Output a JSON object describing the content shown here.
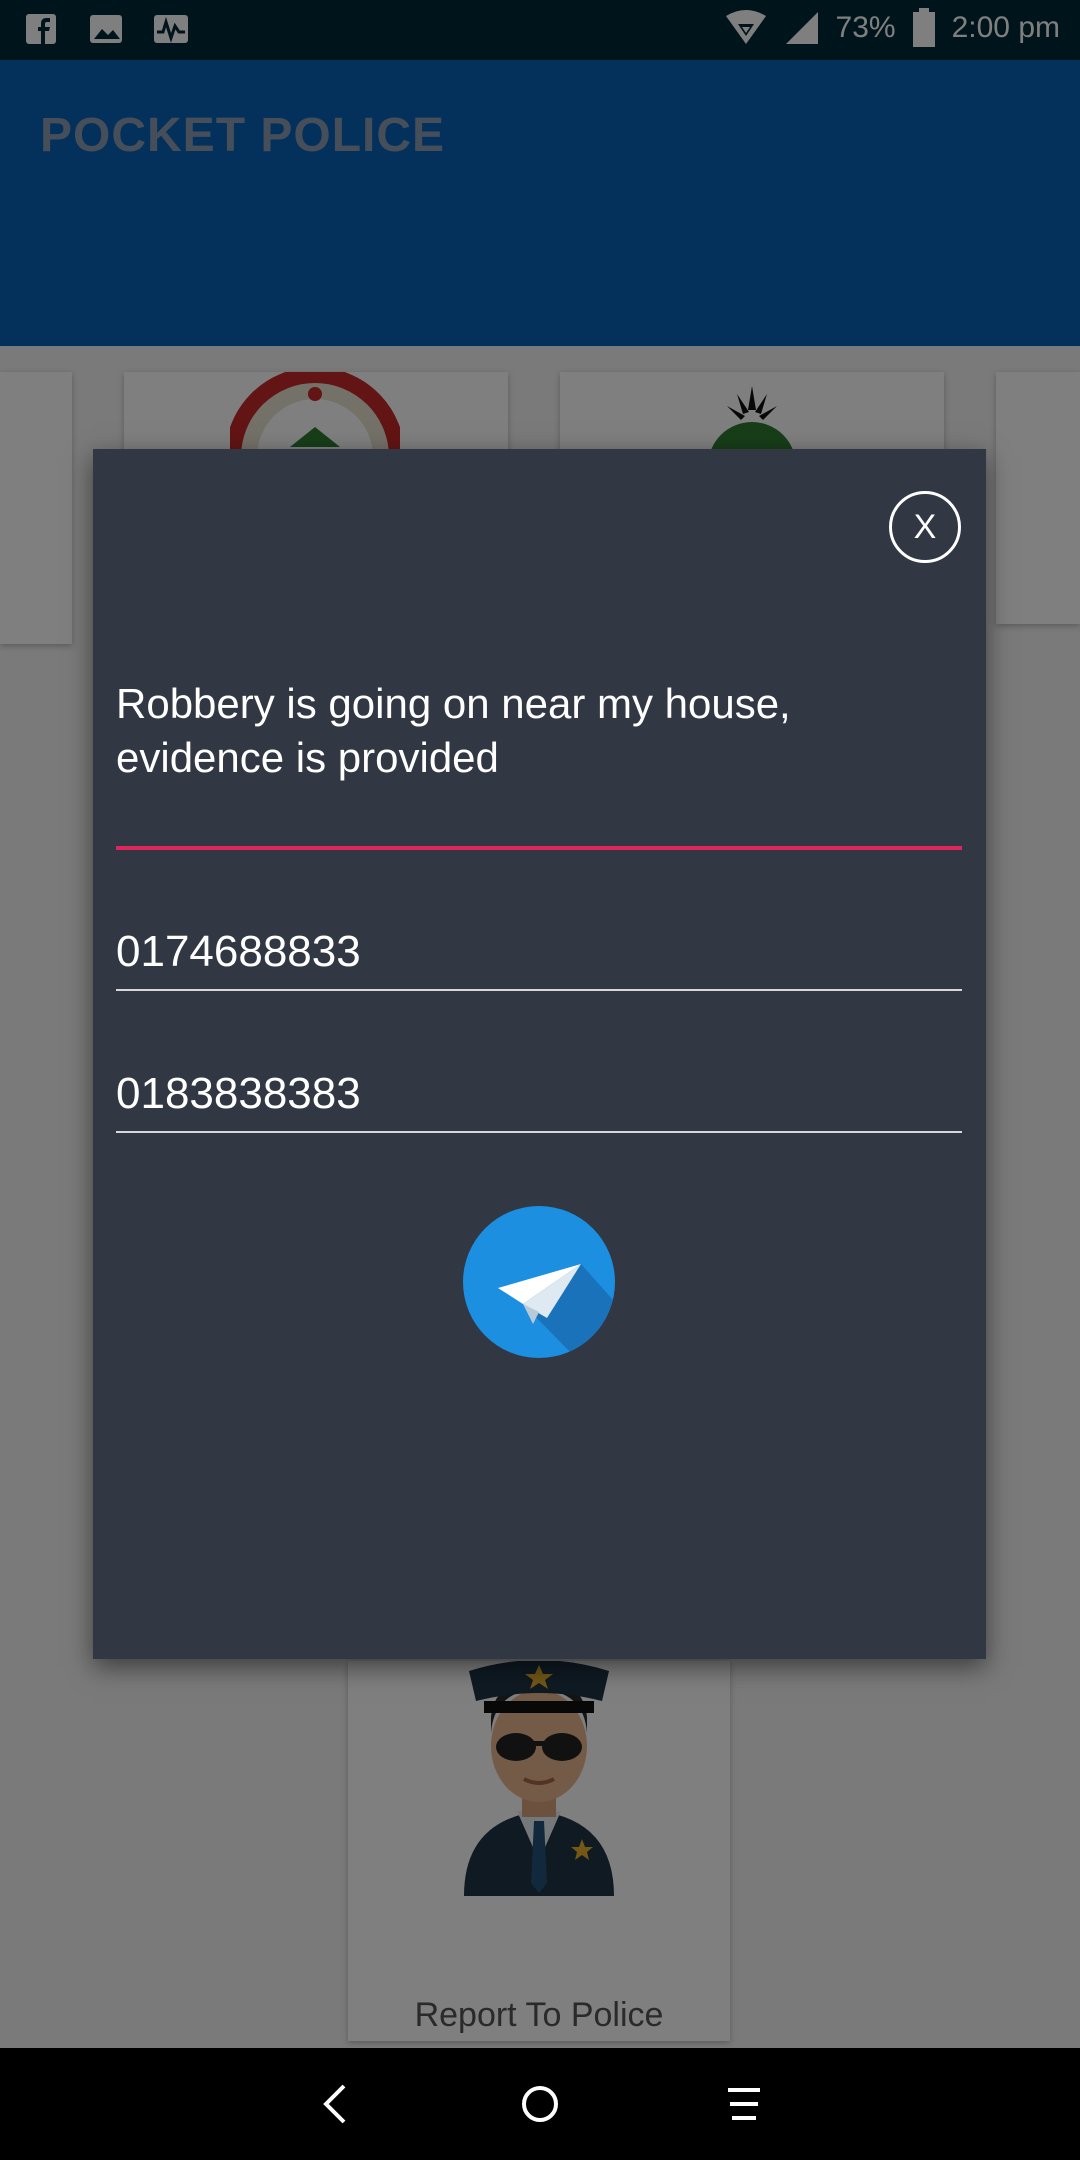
{
  "status_bar": {
    "battery": "73%",
    "time": "2:00 pm"
  },
  "app_bar": {
    "title": "POCKET POLICE"
  },
  "cards": {
    "report_label": "Report To Police"
  },
  "dialog": {
    "close_label": "X",
    "message": "Robbery is going on near my house, evidence is provided",
    "phone_1": "0174688833",
    "phone_2": "0183838383"
  },
  "colors": {
    "status_bar": "#002b36",
    "app_bar": "#0862b8",
    "dialog_bg": "#323744",
    "accent_underline": "#e0245e",
    "send_button": "#1d8fe0"
  },
  "icons": {
    "status_left": [
      "facebook-icon",
      "image-icon",
      "activity-icon"
    ],
    "status_right": [
      "wifi-icon",
      "signal-icon",
      "battery-icon"
    ],
    "send": "paper-plane-icon",
    "nav": [
      "back-icon",
      "home-icon",
      "menu-icon"
    ]
  }
}
